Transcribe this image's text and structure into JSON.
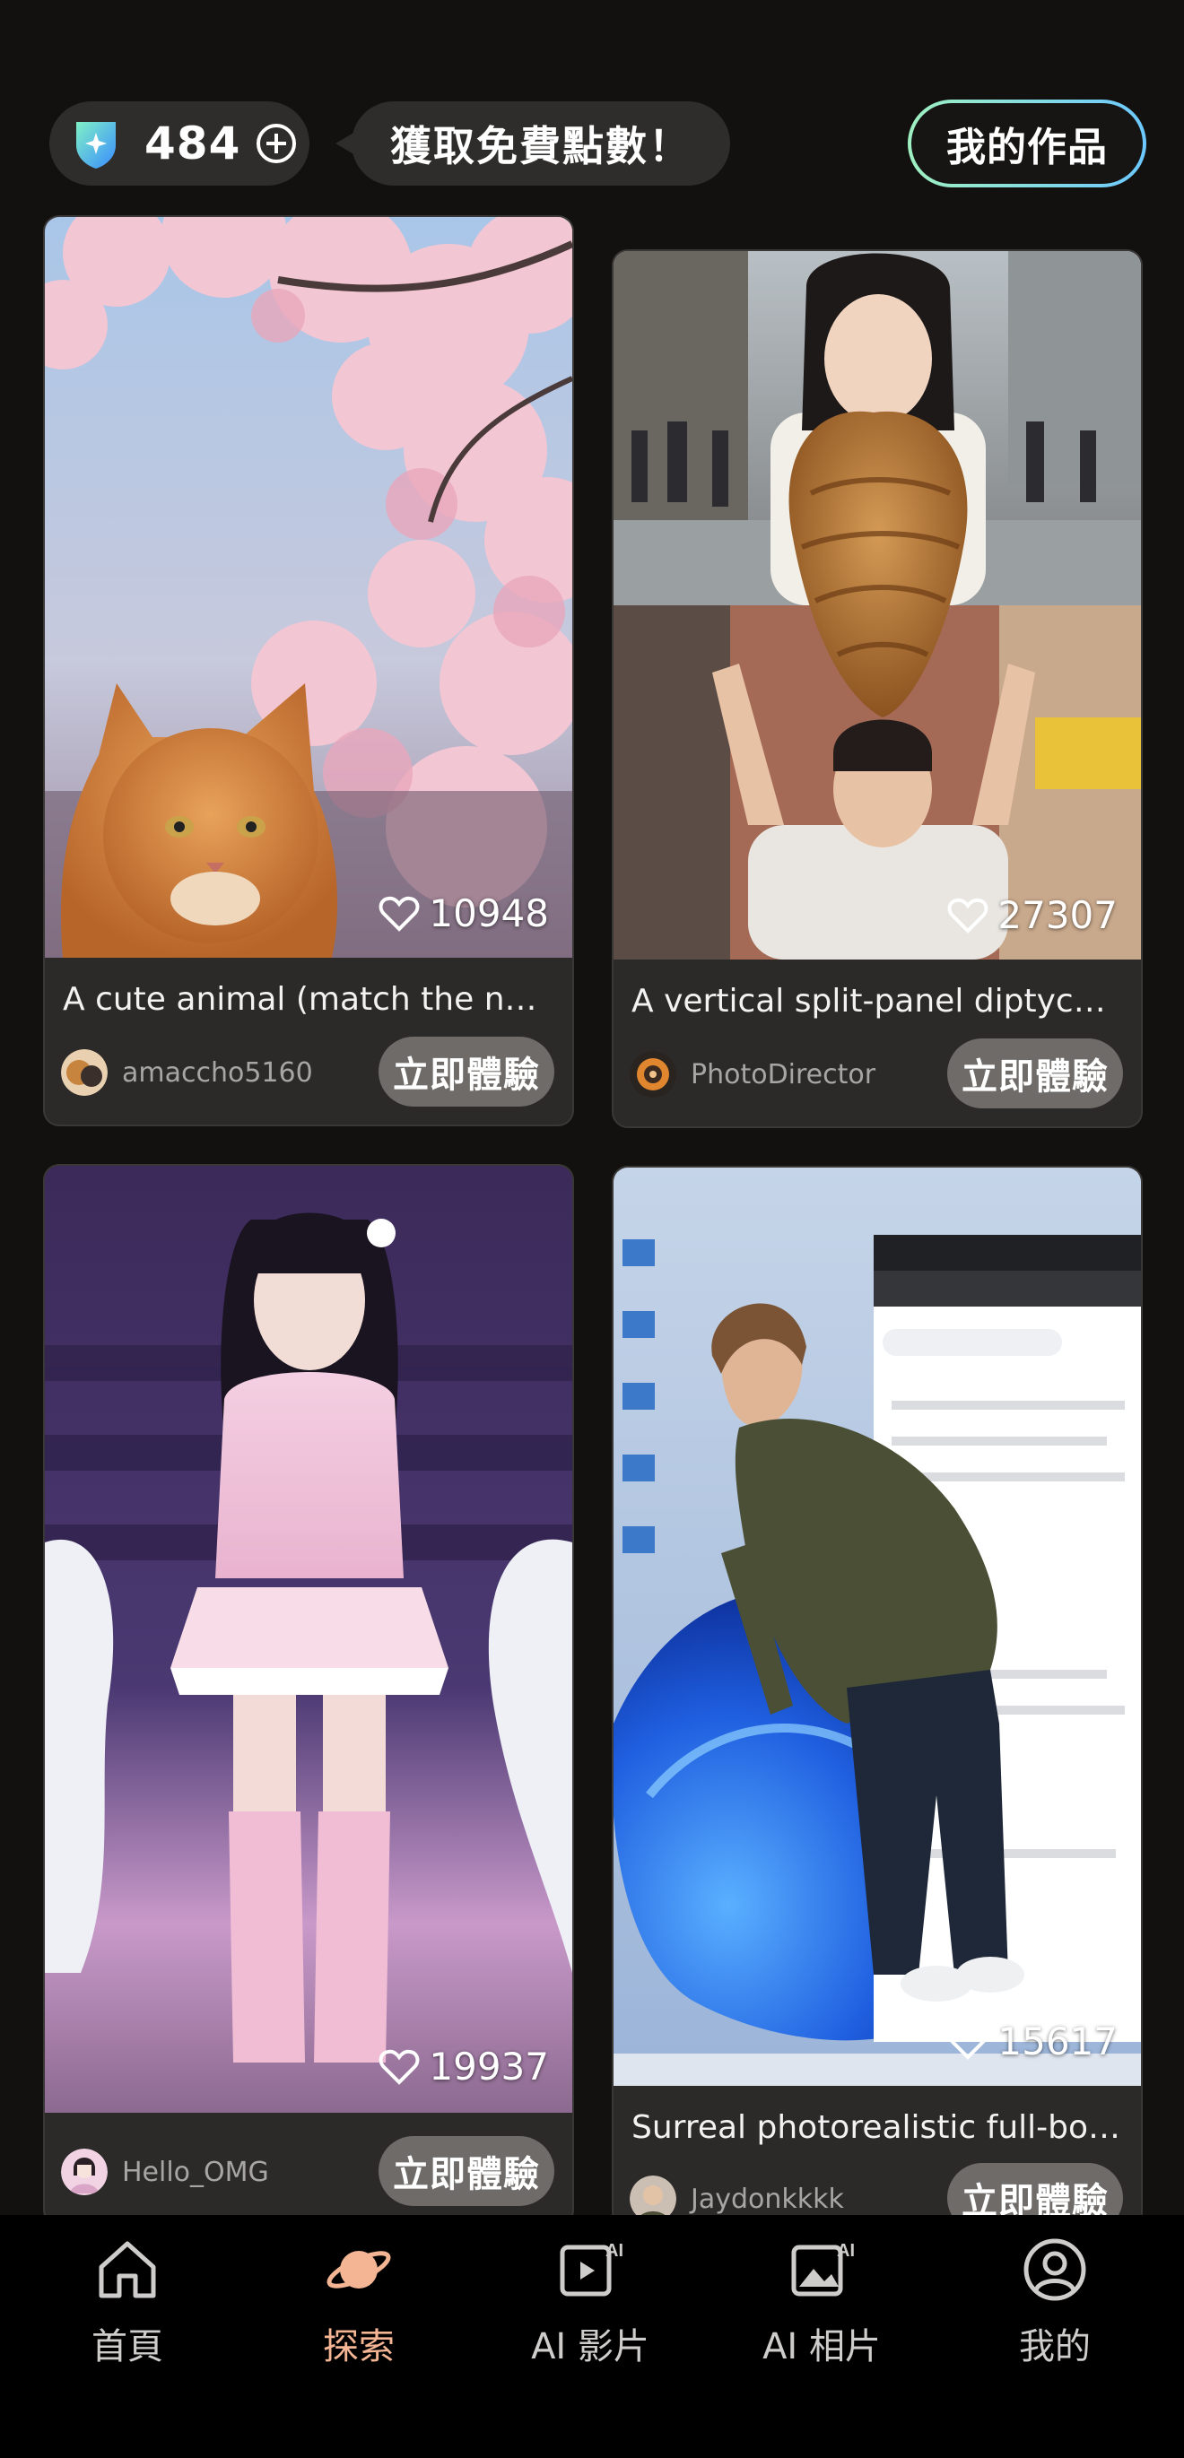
{
  "header": {
    "points": "484",
    "promo_label": "獲取免費點數！",
    "my_works_label": "我的作品"
  },
  "cards": [
    {
      "title": "A cute animal (match the num...",
      "likes": "10948",
      "author": "amaccho5160",
      "button": "立即體驗"
    },
    {
      "title": "A vertical split-panel diptych c...",
      "likes": "27307",
      "author": "PhotoDirector",
      "button": "立即體驗"
    },
    {
      "title": "",
      "likes": "19937",
      "author": "Hello_OMG",
      "button": "立即體驗"
    },
    {
      "title": "Surreal photorealistic full-bod...",
      "likes": "15617",
      "author": "Jaydonkkkk",
      "button": "立即體驗"
    }
  ],
  "nav": [
    {
      "label": "首頁",
      "icon": "home-icon"
    },
    {
      "label": "探索",
      "icon": "planet-icon",
      "active": true
    },
    {
      "label": "AI 影片",
      "icon": "ai-video-icon"
    },
    {
      "label": "AI 相片",
      "icon": "ai-photo-icon"
    },
    {
      "label": "我的",
      "icon": "profile-icon"
    }
  ],
  "colors": {
    "background": "#121110",
    "card": "#2c2a29",
    "active_nav": "#f3b593",
    "accent_border": "#74d4e6"
  }
}
